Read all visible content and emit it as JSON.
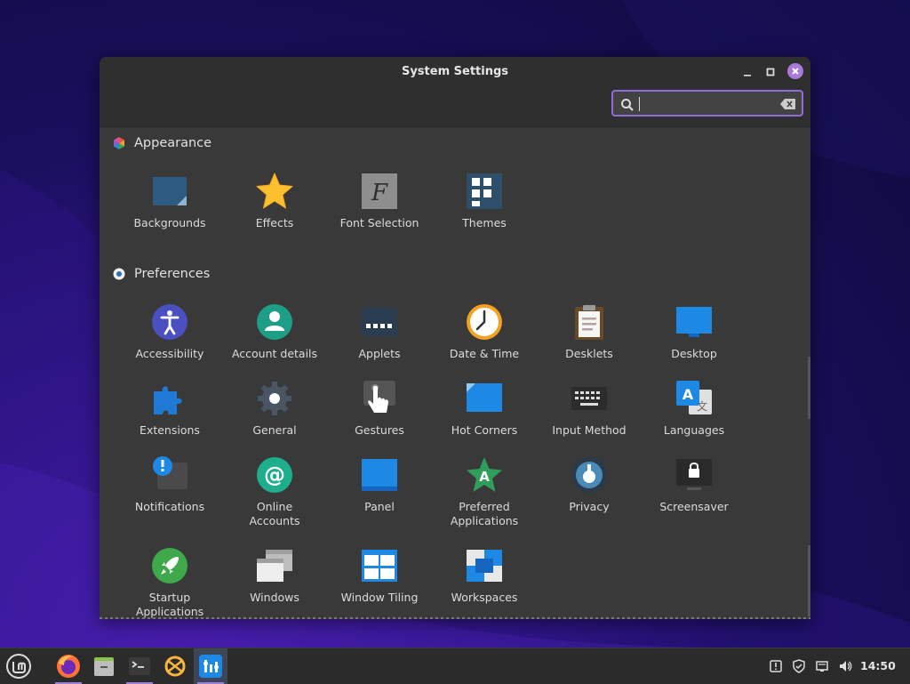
{
  "window": {
    "title": "System Settings",
    "search": {
      "value": "",
      "placeholder": ""
    }
  },
  "sections": [
    {
      "title": "Appearance",
      "icon": "appearance-icon"
    },
    {
      "title": "Preferences",
      "icon": "preferences-icon"
    }
  ],
  "appearance_items": [
    {
      "label": "Backgrounds",
      "icon": "backgrounds-icon"
    },
    {
      "label": "Effects",
      "icon": "star-icon"
    },
    {
      "label": "Font Selection",
      "icon": "font-icon"
    },
    {
      "label": "Themes",
      "icon": "themes-icon"
    }
  ],
  "preference_items": [
    {
      "label": "Accessibility",
      "icon": "accessibility-icon"
    },
    {
      "label": "Account details",
      "icon": "account-icon"
    },
    {
      "label": "Applets",
      "icon": "applets-icon"
    },
    {
      "label": "Date & Time",
      "icon": "clock-icon"
    },
    {
      "label": "Desklets",
      "icon": "desklets-icon"
    },
    {
      "label": "Desktop",
      "icon": "desktop-icon"
    },
    {
      "label": "Extensions",
      "icon": "puzzle-icon"
    },
    {
      "label": "General",
      "icon": "gear-icon"
    },
    {
      "label": "Gestures",
      "icon": "gesture-hand-icon"
    },
    {
      "label": "Hot Corners",
      "icon": "hot-corners-icon"
    },
    {
      "label": "Input Method",
      "icon": "keyboard-icon"
    },
    {
      "label": "Languages",
      "icon": "languages-icon"
    },
    {
      "label": "Notifications",
      "icon": "notifications-icon"
    },
    {
      "label": "Online\nAccounts",
      "icon": "at-icon"
    },
    {
      "label": "Panel",
      "icon": "panel-icon"
    },
    {
      "label": "Preferred\nApplications",
      "icon": "preferred-apps-icon"
    },
    {
      "label": "Privacy",
      "icon": "privacy-icon"
    },
    {
      "label": "Screensaver",
      "icon": "lock-screen-icon"
    },
    {
      "label": "Startup\nApplications",
      "icon": "rocket-icon"
    },
    {
      "label": "Windows",
      "icon": "windows-icon"
    },
    {
      "label": "Window Tiling",
      "icon": "window-tiling-icon"
    },
    {
      "label": "Workspaces",
      "icon": "workspaces-icon"
    }
  ],
  "taskbar": {
    "apps": [
      "mint-menu-icon",
      "firefox-icon",
      "files-icon",
      "terminal-icon",
      "update-manager-icon",
      "system-settings-icon"
    ],
    "tray": [
      "notification-tray-icon",
      "shield-icon",
      "network-icon",
      "volume-icon"
    ],
    "clock": "14:50"
  },
  "colors": {
    "accent": "#9b7fd6",
    "window_bg": "#393939",
    "titlebar": "#2f2f2f"
  }
}
